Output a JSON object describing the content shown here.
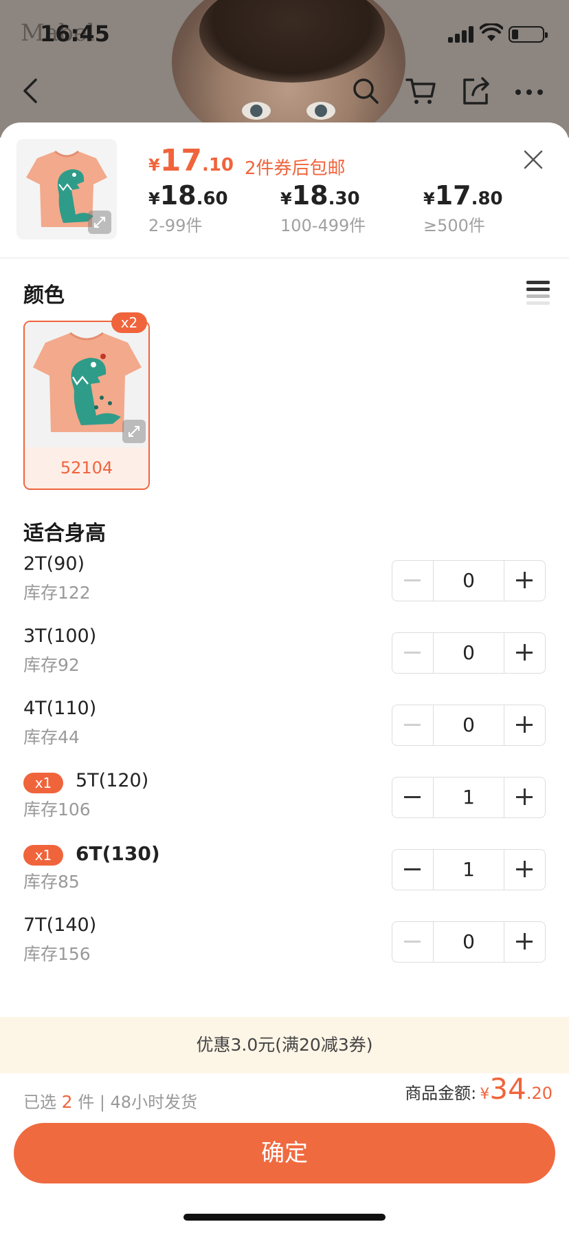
{
  "status_bar": {
    "time": "16:45"
  },
  "background": {
    "logo_text": "Mabel"
  },
  "product": {
    "main_price": {
      "currency": "¥",
      "integer": "17",
      "decimal": ".10"
    },
    "promo": "2件券后包邮",
    "tiers": [
      {
        "currency": "¥",
        "integer": "18",
        "decimal": ".60",
        "range": "2-99件"
      },
      {
        "currency": "¥",
        "integer": "18",
        "decimal": ".30",
        "range": "100-499件"
      },
      {
        "currency": "¥",
        "integer": "17",
        "decimal": ".80",
        "range": "≥500件"
      }
    ]
  },
  "color_section": {
    "title": "颜色",
    "options": [
      {
        "label": "52104",
        "badge": "x2"
      }
    ]
  },
  "size_section": {
    "title": "适合身高",
    "sizes": [
      {
        "name": "2T(90)",
        "stock": "库存122",
        "qty": "0",
        "badge": ""
      },
      {
        "name": "3T(100)",
        "stock": "库存92",
        "qty": "0",
        "badge": ""
      },
      {
        "name": "4T(110)",
        "stock": "库存44",
        "qty": "0",
        "badge": ""
      },
      {
        "name": "5T(120)",
        "stock": "库存106",
        "qty": "1",
        "badge": "x1"
      },
      {
        "name": "6T(130)",
        "stock": "库存85",
        "qty": "1",
        "badge": "x1"
      },
      {
        "name": "7T(140)",
        "stock": "库存156",
        "qty": "0",
        "badge": ""
      }
    ]
  },
  "discount": "优惠3.0元(满20减3券)",
  "footer": {
    "selected_prefix": "已选",
    "selected_count": "2",
    "selected_suffix": "件 | 48小时发货",
    "total_label": "商品金额:",
    "total": {
      "currency": "¥",
      "integer": "34",
      "decimal": ".20"
    },
    "confirm_label": "确定"
  },
  "colors": {
    "accent": "#f0643c",
    "discount_bg": "#fdf5e6"
  }
}
